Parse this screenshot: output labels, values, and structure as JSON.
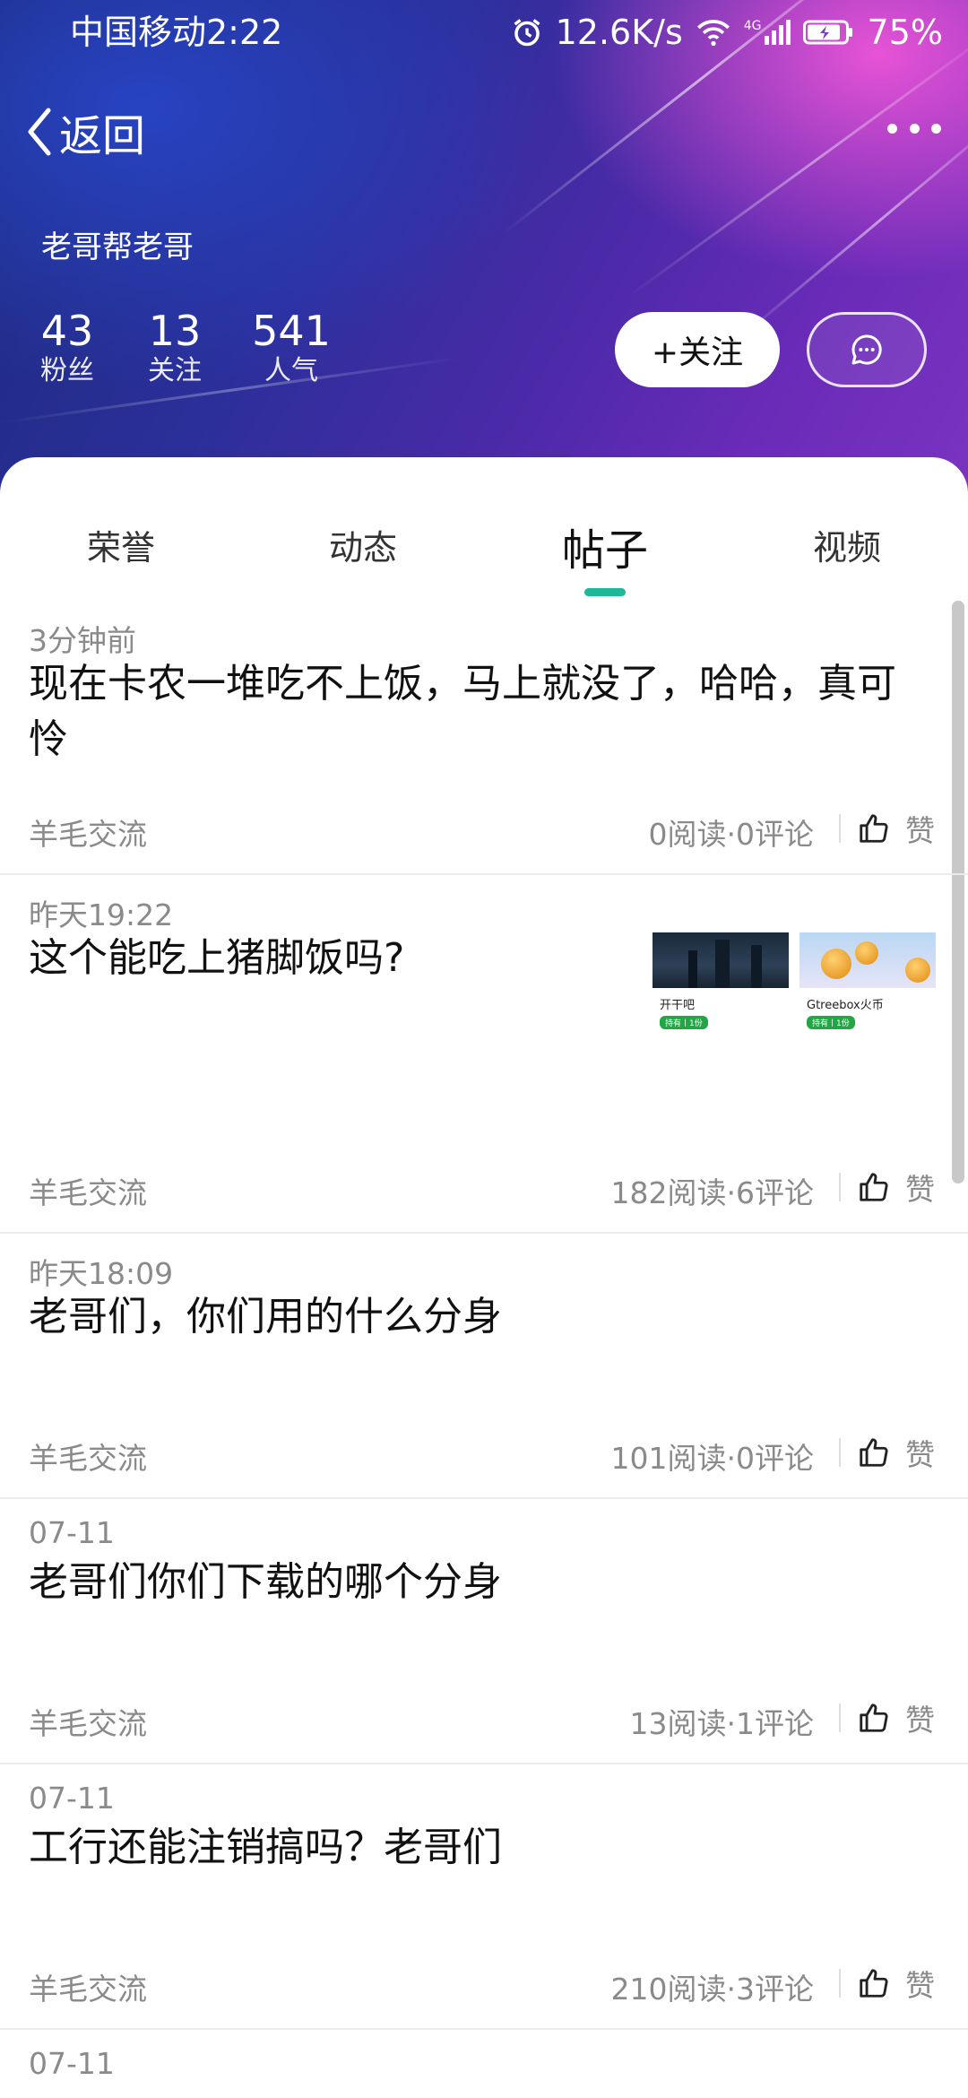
{
  "status_bar": {
    "carrier_time": "中国移动2:22",
    "net_speed": "12.6K/s",
    "network_type": "4G",
    "battery": "75%"
  },
  "nav": {
    "back_label": "返回"
  },
  "profile": {
    "name": "老哥帮老哥",
    "stats": [
      {
        "value": "43",
        "label": "粉丝"
      },
      {
        "value": "13",
        "label": "关注"
      },
      {
        "value": "541",
        "label": "人气"
      }
    ],
    "follow_label": "+关注"
  },
  "tabs": [
    {
      "label": "荣誉"
    },
    {
      "label": "动态"
    },
    {
      "label": "帖子"
    },
    {
      "label": "视频"
    }
  ],
  "active_tab": "帖子",
  "accent_color": "#1fb79a",
  "posts": [
    {
      "time": "3分钟前",
      "title": "现在卡农一堆吃不上饭，马上就没了，哈哈，真可怜",
      "category": "羊毛交流",
      "stats": "0阅读·0评论",
      "like": "赞"
    },
    {
      "time": "昨天19:22",
      "title": "这个能吃上猪脚饭吗?",
      "category": "羊毛交流",
      "stats": "182阅读·6评论",
      "like": "赞",
      "thumbs": [
        {
          "caption": "开干吧",
          "tag": "持有丨1份"
        },
        {
          "caption": "Gtreebox火币",
          "tag": "持有丨1份"
        }
      ]
    },
    {
      "time": "昨天18:09",
      "title": "老哥们，你们用的什么分身",
      "category": "羊毛交流",
      "stats": "101阅读·0评论",
      "like": "赞"
    },
    {
      "time": "07-11",
      "title": "老哥们你们下载的哪个分身",
      "category": "羊毛交流",
      "stats": "13阅读·1评论",
      "like": "赞"
    },
    {
      "time": "07-11",
      "title": "工行还能注销搞吗？老哥们",
      "category": "羊毛交流",
      "stats": "210阅读·3评论",
      "like": "赞"
    },
    {
      "time": "07-11"
    }
  ]
}
